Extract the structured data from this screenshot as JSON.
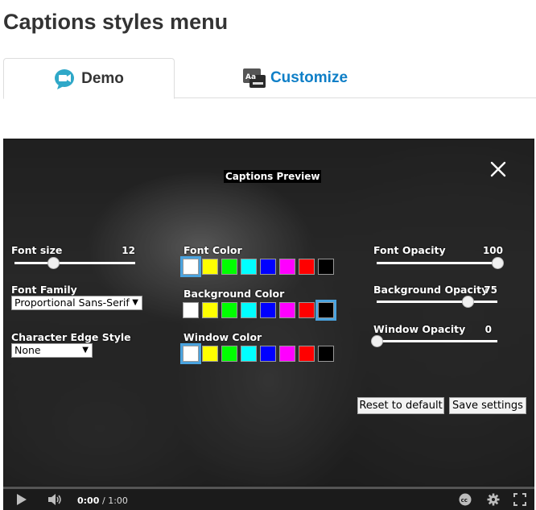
{
  "page": {
    "title": "Captions styles menu"
  },
  "tabs": [
    {
      "label": "Demo",
      "active": true,
      "icon": "video-chat-icon"
    },
    {
      "label": "Customize",
      "active": false,
      "icon": "caption-style-icon"
    }
  ],
  "colors": {
    "accent": "#0f7fc7",
    "selection": "#4aa3df"
  },
  "captions_menu": {
    "preview_label": "Captions Preview",
    "close_icon": "close-icon",
    "font_size": {
      "label": "Font size",
      "value": "12",
      "level": 0.32
    },
    "font_family": {
      "label": "Font Family",
      "selected": "Proportional Sans-Serif"
    },
    "edge_style": {
      "label": "Character Edge Style",
      "selected": "None"
    },
    "font_color": {
      "label": "Font Color",
      "selected_index": 0
    },
    "background_color": {
      "label": "Background Color",
      "selected_index": 7
    },
    "window_color": {
      "label": "Window Color",
      "selected_index": 0
    },
    "swatch_colors": [
      "#ffffff",
      "#ffff00",
      "#00ff00",
      "#00ffff",
      "#0000ff",
      "#ff00ff",
      "#ff0000",
      "#000000"
    ],
    "font_opacity": {
      "label": "Font Opacity",
      "value": "100",
      "level": 1.0
    },
    "background_opacity": {
      "label": "Background Opacity",
      "value": "75",
      "level": 0.75
    },
    "window_opacity": {
      "label": "Window Opacity",
      "value": "0",
      "level": 0.0
    },
    "reset_label": "Reset to default",
    "save_label": "Save settings"
  },
  "player": {
    "current_time": "0:00",
    "total_time": "/ 1:00",
    "progress": 0
  }
}
